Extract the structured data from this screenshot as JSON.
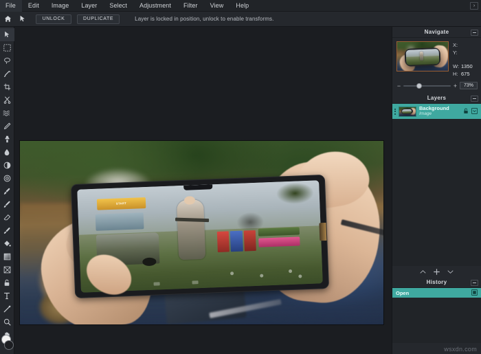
{
  "menubar": {
    "items": [
      {
        "label": "File"
      },
      {
        "label": "Edit"
      },
      {
        "label": "Image"
      },
      {
        "label": "Layer"
      },
      {
        "label": "Select"
      },
      {
        "label": "Adjustment"
      },
      {
        "label": "Filter"
      },
      {
        "label": "View"
      },
      {
        "label": "Help"
      }
    ],
    "window_control": "›"
  },
  "optionbar": {
    "home_icon": "home-icon",
    "move_icon": "move-tool-icon",
    "unlock_label": "UNLOCK",
    "duplicate_label": "DUPLICATE",
    "status_text": "Layer is locked in position, unlock to enable transforms."
  },
  "toolbar": {
    "tools": [
      {
        "name": "move-tool",
        "active": true
      },
      {
        "name": "marquee-select-tool",
        "active": false
      },
      {
        "name": "lasso-tool",
        "active": false
      },
      {
        "name": "magic-wand-tool",
        "active": false
      },
      {
        "name": "crop-tool",
        "active": false
      },
      {
        "name": "scissors-tool",
        "active": false
      },
      {
        "name": "liquify-tool",
        "active": false
      },
      {
        "name": "pencil-tool",
        "active": false
      },
      {
        "name": "clone-stamp-tool",
        "active": false
      },
      {
        "name": "blur-drop-tool",
        "active": false
      },
      {
        "name": "dodge-burn-tool",
        "active": false
      },
      {
        "name": "sharpen-tool",
        "active": false
      },
      {
        "name": "brush-tool",
        "active": false
      },
      {
        "name": "paint-brush-tool",
        "active": false
      },
      {
        "name": "eraser-tool",
        "active": false
      },
      {
        "name": "ink-tool",
        "active": false
      },
      {
        "name": "paint-bucket-tool",
        "active": false
      },
      {
        "name": "gradient-tool",
        "active": false
      },
      {
        "name": "shape-tool",
        "active": false
      },
      {
        "name": "lock-tool",
        "active": false
      },
      {
        "name": "text-tool",
        "active": false
      },
      {
        "name": "line-tool",
        "active": false
      },
      {
        "name": "zoom-tool",
        "active": false
      },
      {
        "name": "hand-tool",
        "active": false
      }
    ],
    "foreground_color": "#f2f2f2",
    "background_color": "#1c1e22"
  },
  "navigate": {
    "title": "Navigate",
    "x_label": "X:",
    "x_value": "",
    "y_label": "Y:",
    "y_value": "",
    "w_label": "W:",
    "w_value": "1350",
    "h_label": "H:",
    "h_value": "675",
    "zoom_minus": "−",
    "zoom_plus": "+",
    "zoom_value": "73%"
  },
  "layers": {
    "title": "Layers",
    "items": [
      {
        "name": "Background",
        "kind": "Image",
        "locked": true,
        "selected": true
      }
    ],
    "controls": {
      "move_up": "chevron-up-icon",
      "add": "plus-icon",
      "move_down": "chevron-down-icon"
    }
  },
  "history": {
    "title": "History",
    "items": [
      {
        "label": "Open",
        "selected": true
      }
    ]
  },
  "canvas": {
    "image_alt": "Hands holding a smartphone playing a battle-royale mobile game on a wooden table",
    "game_hud_label": "START"
  },
  "watermark": "wsxdn.com",
  "colors": {
    "accent": "#3fa9a0",
    "panel_bg": "#25282d",
    "app_bg": "#1b1d21",
    "thumb_border": "#9a5f33"
  }
}
